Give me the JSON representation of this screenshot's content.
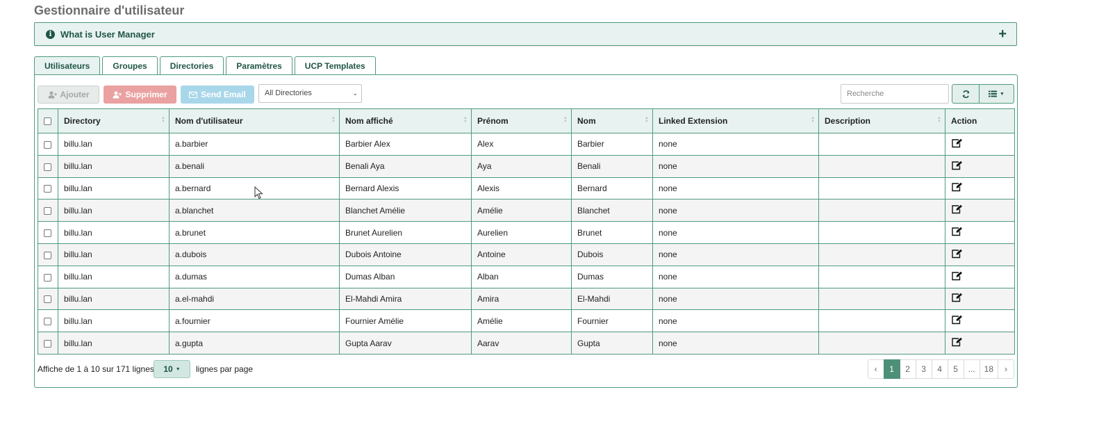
{
  "page": {
    "title": "Gestionnaire d'utilisateur"
  },
  "info_panel": {
    "title": "What is User Manager",
    "icon": "info-circle-icon",
    "expand_icon": "plus-icon"
  },
  "tabs": [
    {
      "label": "Utilisateurs",
      "active": true
    },
    {
      "label": "Groupes",
      "active": false
    },
    {
      "label": "Directories",
      "active": false
    },
    {
      "label": "Paramètres",
      "active": false
    },
    {
      "label": "UCP Templates",
      "active": false
    }
  ],
  "toolbar": {
    "add_label": "Ajouter",
    "delete_label": "Supprimer",
    "send_email_label": "Send Email",
    "directory_filter": "All Directories",
    "search_placeholder": "Recherche",
    "refresh_icon": "refresh-icon",
    "columns_icon": "list-columns-icon"
  },
  "table": {
    "columns": [
      "Directory",
      "Nom d'utilisateur",
      "Nom affiché",
      "Prénom",
      "Nom",
      "Linked Extension",
      "Description",
      "Action"
    ],
    "rows": [
      {
        "directory": "billu.lan",
        "username": "a.barbier",
        "display": "Barbier Alex",
        "first": "Alex",
        "last": "Barbier",
        "ext": "none",
        "desc": ""
      },
      {
        "directory": "billu.lan",
        "username": "a.benali",
        "display": "Benali Aya",
        "first": "Aya",
        "last": "Benali",
        "ext": "none",
        "desc": ""
      },
      {
        "directory": "billu.lan",
        "username": "a.bernard",
        "display": "Bernard Alexis",
        "first": "Alexis",
        "last": "Bernard",
        "ext": "none",
        "desc": ""
      },
      {
        "directory": "billu.lan",
        "username": "a.blanchet",
        "display": "Blanchet Amélie",
        "first": "Amélie",
        "last": "Blanchet",
        "ext": "none",
        "desc": ""
      },
      {
        "directory": "billu.lan",
        "username": "a.brunet",
        "display": "Brunet Aurelien",
        "first": "Aurelien",
        "last": "Brunet",
        "ext": "none",
        "desc": ""
      },
      {
        "directory": "billu.lan",
        "username": "a.dubois",
        "display": "Dubois Antoine",
        "first": "Antoine",
        "last": "Dubois",
        "ext": "none",
        "desc": ""
      },
      {
        "directory": "billu.lan",
        "username": "a.dumas",
        "display": "Dumas Alban",
        "first": "Alban",
        "last": "Dumas",
        "ext": "none",
        "desc": ""
      },
      {
        "directory": "billu.lan",
        "username": "a.el-mahdi",
        "display": "El-Mahdi Amira",
        "first": "Amira",
        "last": "El-Mahdi",
        "ext": "none",
        "desc": ""
      },
      {
        "directory": "billu.lan",
        "username": "a.fournier",
        "display": "Fournier Amélie",
        "first": "Amélie",
        "last": "Fournier",
        "ext": "none",
        "desc": ""
      },
      {
        "directory": "billu.lan",
        "username": "a.gupta",
        "display": "Gupta Aarav",
        "first": "Aarav",
        "last": "Gupta",
        "ext": "none",
        "desc": ""
      }
    ]
  },
  "footer": {
    "summary": "Affiche de 1 à 10 sur 171 lignes",
    "page_size": "10",
    "per_page_label": "lignes par page",
    "pages": [
      "‹",
      "1",
      "2",
      "3",
      "4",
      "5",
      "...",
      "18",
      "›"
    ],
    "current_page": "1"
  },
  "colors": {
    "accent": "#4f9a7c",
    "accent_dark": "#1f5546",
    "panel_bg": "#e8f3f1",
    "danger": "#eaa1a1",
    "info": "#a9d7ea",
    "active_page": "#4d8f77"
  }
}
